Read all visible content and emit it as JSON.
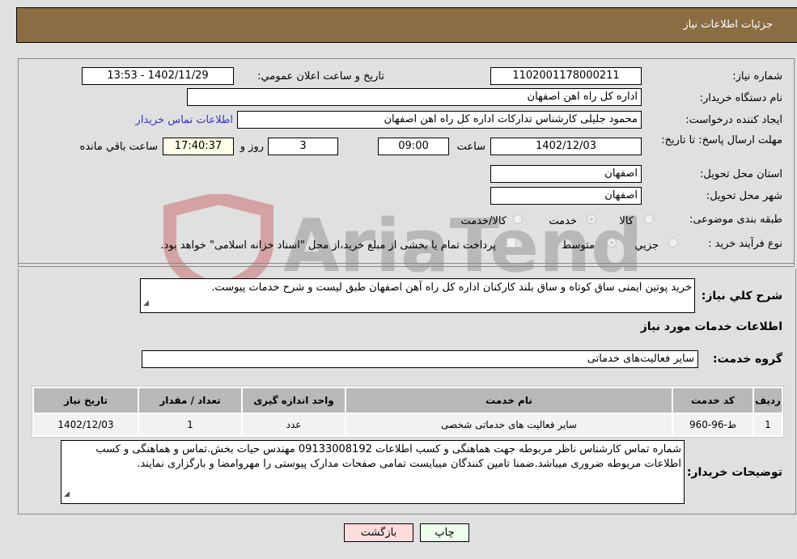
{
  "header": {
    "title": "جزئیات اطلاعات نیاز"
  },
  "form": {
    "need_number_label": "شماره نیاز:",
    "need_number": "1102001178000211",
    "announce_label": "تاریخ و ساعت اعلان عمومي:",
    "announce_value": "1402/11/29 - 13:53",
    "buyer_org_label": "نام دستگاه خریدار:",
    "buyer_org": "اداره کل راه اهن اصفهان",
    "creator_label": "ایجاد کننده درخواست:",
    "creator": "محمود جلیلی کارشناس تدارکات اداره کل راه اهن اصفهان",
    "contact_link": "اطلاعات تماس خریدار",
    "deadline_label": "مهلت ارسال پاسخ: تا تاریخ:",
    "deadline_date": "1402/12/03",
    "time_label": "ساعت",
    "deadline_time": "09:00",
    "days_value": "3",
    "days_label": "روز و",
    "remaining_time": "17:40:37",
    "remaining_label": "ساعت باقي مانده",
    "province_label": "استان محل تحویل:",
    "province": "اصفهان",
    "city_label": "شهر محل تحویل:",
    "city": "اصفهان",
    "category_label": "طبقه بندی موضوعی:",
    "category_options": [
      "کالا",
      "خدمت",
      "کالا/خدمت"
    ],
    "category_selected": "خدمت",
    "process_label": "نوع فرآیند خرید :",
    "process_options": [
      "جزيي",
      "متوسط"
    ],
    "process_selected": "متوسط",
    "treasury_note": "پرداخت تمام یا بخشی از مبلغ خرید،از محل \"اسناد خزانه اسلامی\" خواهد بود."
  },
  "description": {
    "label": "شرح کلي نیاز:",
    "text": "خرید پوتین ایمنی ساق کوتاه و ساق بلند کارکنان اداره کل راه آهن اصفهان طبق لیست و  شرح خدمات پیوست."
  },
  "services": {
    "section_title": "اطلاعات خدمات مورد نیاز",
    "group_label": "گروه خدمت:",
    "group_value": "سایر فعالیت‌های خدماتی",
    "table": {
      "headers": [
        "ردیف",
        "کد خدمت",
        "نام خدمت",
        "واحد اندازه گیری",
        "تعداد / مقدار",
        "تاریخ نیاز"
      ],
      "rows": [
        [
          "1",
          "ط-96-960",
          "سایر فعالیت های خدماتی شخصی",
          "عدد",
          "1",
          "1402/12/03"
        ]
      ]
    }
  },
  "buyer_notes": {
    "label": "توضیحات خریدار:",
    "text": "شماره تماس کارشناس ناظر  مربوطه جهت هماهنگی و کسب اطلاعات 09133008192 مهندس حیات بخش.تماس و هماهنگی و کسب اطلاعات مربوطه ضروری میباشد.ضمنا تامین کنندگان میبایست تمامی صفحات مدارک پیوستی را مهروامضا و بارگزاری نمایند."
  },
  "buttons": {
    "print": "چاپ",
    "back": "بازگشت"
  },
  "colors": {
    "header_bg": "#8b6d43",
    "print_bg": "#eeffee",
    "back_bg": "#ffdddd",
    "link": "#3333cc"
  }
}
